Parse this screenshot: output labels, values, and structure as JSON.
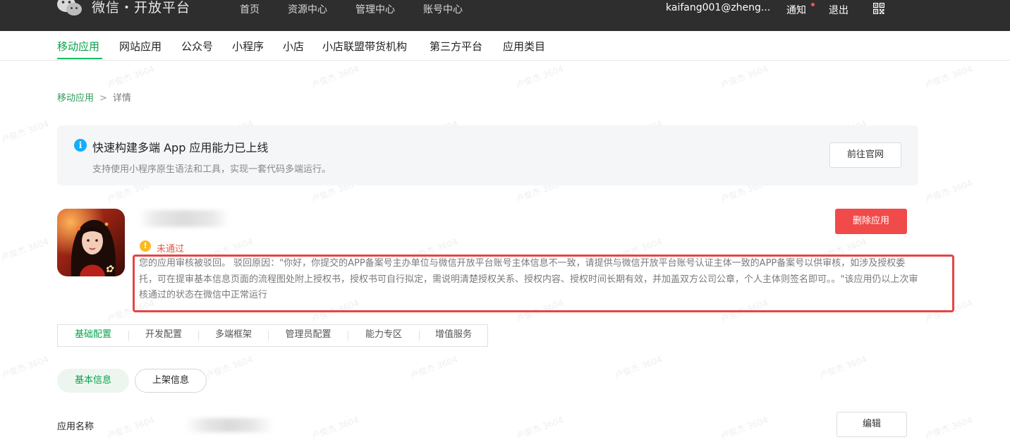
{
  "topbar": {
    "brand": "微信・开放平台",
    "nav": [
      "首页",
      "资源中心",
      "管理中心",
      "账号中心"
    ],
    "account": "kaifang001@zheng...",
    "notice": "通知",
    "logout": "退出"
  },
  "category_tabs": [
    "移动应用",
    "网站应用",
    "公众号",
    "小程序",
    "小店",
    "小店联盟带货机构",
    "第三方平台",
    "应用类目"
  ],
  "breadcrumb": {
    "parent": "移动应用",
    "separator": ">",
    "current": "详情"
  },
  "banner": {
    "title": "快速构建多端 App 应用能力已上线",
    "desc": "支持使用小程序原生语法和工具，实现一套代码多端运行。",
    "button": "前往官网"
  },
  "app": {
    "status": "未通过",
    "delete_button": "删除应用",
    "reject_message": "您的应用审核被驳回。 驳回原因：\"你好，你提交的APP备案号主办单位与微信开放平台账号主体信息不一致，请提供与微信开放平台账号认证主体一致的APP备案号以供审核，如涉及授权委托，可在提审基本信息页面的流程图处附上授权书，授权书可自行拟定，需说明清楚授权关系、授权内容、授权时间长期有效，并加盖双方公司公章，个人主体则签名即可。。\"该应用仍以上次审核通过的状态在微信中正常运行"
  },
  "config_tabs": [
    "基础配置",
    "开发配置",
    "多端框架",
    "管理员配置",
    "能力专区",
    "增值服务"
  ],
  "info_tabs": [
    "基本信息",
    "上架信息"
  ],
  "fields": {
    "app_name_label": "应用名称",
    "edit_button": "编辑"
  },
  "watermark": "卢俊杰 3604",
  "colors": {
    "accent": "#07c160",
    "danger": "#f04a4a",
    "topbar": "#2e2e2e"
  }
}
